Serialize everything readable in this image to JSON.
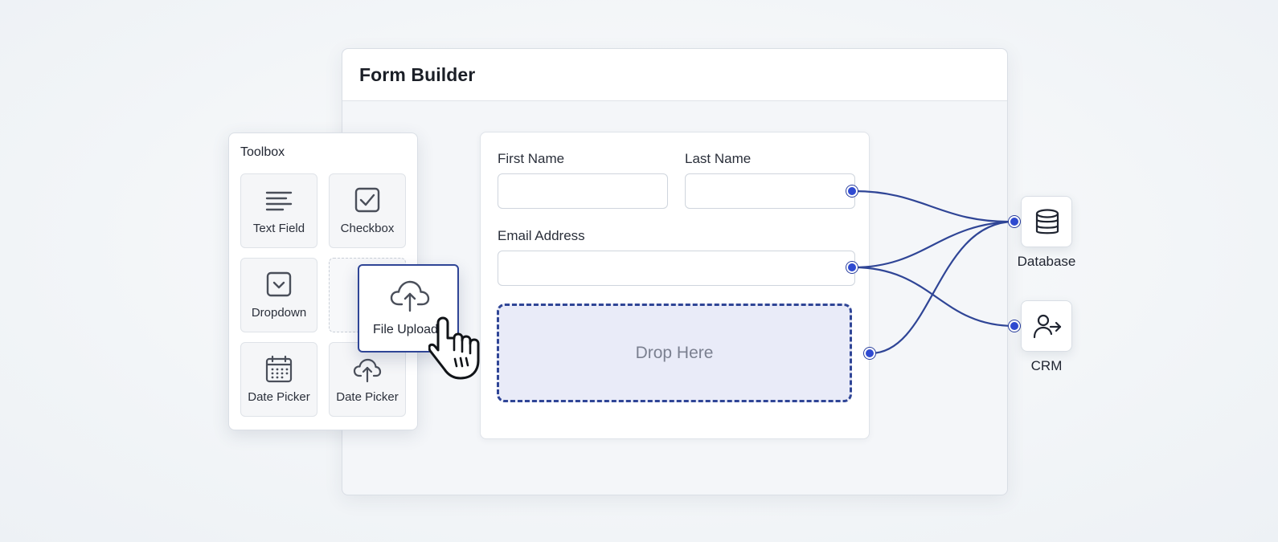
{
  "window": {
    "title": "Form Builder"
  },
  "toolbox": {
    "title": "Toolbox",
    "items": [
      {
        "label": "Text Field",
        "icon": "text-lines-icon"
      },
      {
        "label": "Checkbox",
        "icon": "checkbox-icon"
      },
      {
        "label": "Dropdown",
        "icon": "dropdown-icon"
      },
      {
        "label": "Date Picker",
        "icon": "calendar-icon"
      },
      {
        "label": "Date Picker",
        "icon": "cloud-upload-icon"
      }
    ]
  },
  "dragging": {
    "label": "File Upload",
    "icon": "cloud-upload-icon"
  },
  "form": {
    "first_name_label": "First Name",
    "last_name_label": "Last Name",
    "email_label": "Email Address",
    "first_name_value": "",
    "last_name_value": "",
    "email_value": "",
    "drop_text": "Drop Here"
  },
  "targets": {
    "database_label": "Database",
    "crm_label": "CRM"
  },
  "colors": {
    "accent": "#2f4596",
    "port": "#2f4ad1",
    "drop_bg": "#e9ebf8"
  }
}
